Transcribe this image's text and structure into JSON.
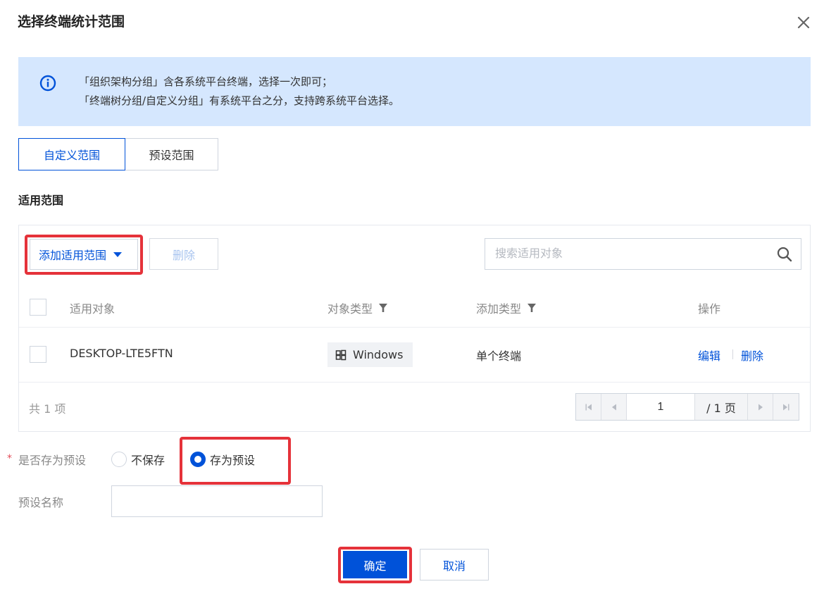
{
  "dialog": {
    "title": "选择终端统计范围"
  },
  "notice": {
    "line1": "「组织架构分组」含各系统平台终端，选择一次即可；",
    "line2": "「终端树分组/自定义分组」有系统平台之分，支持跨系统平台选择。"
  },
  "tabs": [
    {
      "label": "自定义范围",
      "active": true
    },
    {
      "label": "预设范围",
      "active": false
    }
  ],
  "scope": {
    "section_label": "适用范围",
    "add_label": "添加适用范围",
    "delete_label": "删除",
    "search_placeholder": "搜索适用对象",
    "columns": [
      "适用对象",
      "对象类型",
      "添加类型",
      "操作"
    ],
    "rows": [
      {
        "object": "DESKTOP-LTE5FTN",
        "type": "Windows",
        "add_type": "单个终端",
        "edit": "编辑",
        "delete": "删除"
      }
    ],
    "total_text": "共 1 项",
    "page": "1",
    "page_total": "/ 1 页"
  },
  "save_preset": {
    "label": "是否存为预设",
    "required_mark": "*",
    "options": [
      {
        "label": "不保存",
        "checked": false
      },
      {
        "label": "存为预设",
        "checked": true
      }
    ]
  },
  "preset_name": {
    "label": "预设名称",
    "value": ""
  },
  "footer": {
    "ok_label": "确定",
    "cancel_label": "取消"
  },
  "colors": {
    "brand": "#0052d9",
    "notice_bg": "#d5e7fe",
    "highlight": "#e5323a"
  },
  "icons": [
    "close-icon",
    "info-icon",
    "caret-down-icon",
    "search-icon",
    "filter-icon",
    "windows-icon",
    "first-page-icon",
    "prev-page-icon",
    "next-page-icon",
    "last-page-icon"
  ]
}
